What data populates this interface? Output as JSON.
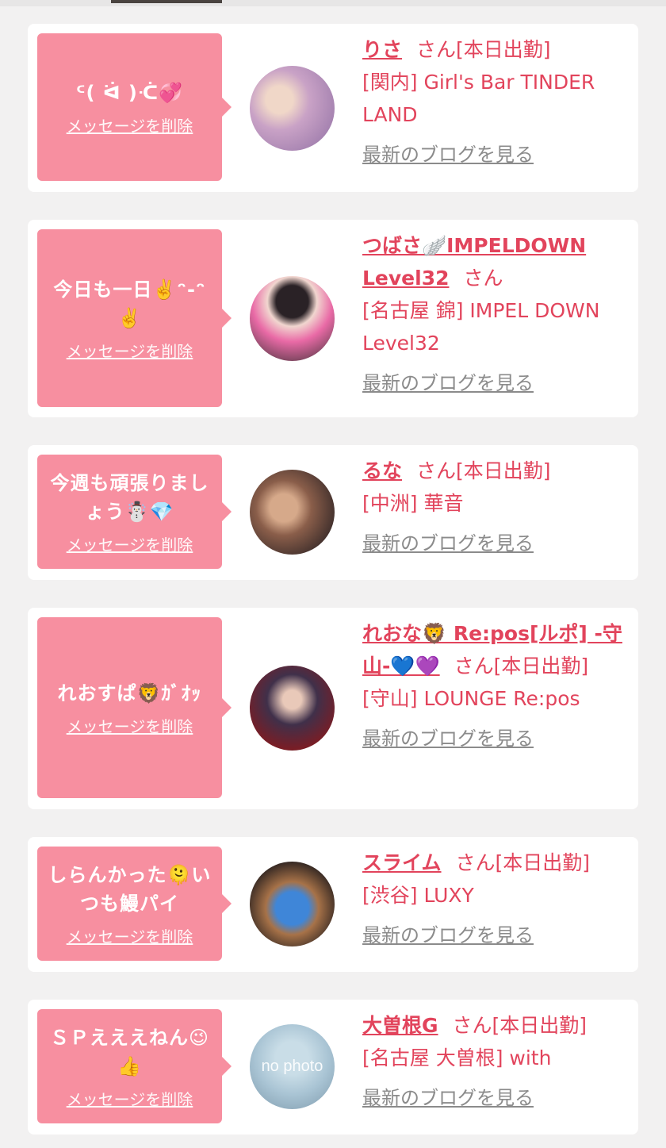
{
  "cards": [
    {
      "message": "ᑦ( ᐛ )ᑣ💞",
      "delete_label": "メッセージを削除",
      "name": "りさ",
      "san": "さん[本日出勤]",
      "shop": "[関内] Girl's Bar TINDER LAND",
      "blog_label": "最新のブログを見る",
      "avatar_colors": [
        "#c9a2c6",
        "#e6c7b4"
      ]
    },
    {
      "message": "今日も一日✌️ᵔ-ᵔ✌️",
      "delete_label": "メッセージを削除",
      "name": "つばさ🪽IMPELDOWN Level32",
      "san": "さん",
      "shop": "[名古屋 錦] IMPEL DOWN Level32",
      "blog_label": "最新のブログを見る",
      "avatar_colors": [
        "#e96aa6",
        "#2a2226"
      ]
    },
    {
      "message": "今週も頑張りましょう☃️💎",
      "delete_label": "メッセージを削除",
      "name": "るな",
      "san": "さん[本日出勤]",
      "shop": "[中洲] 華音",
      "blog_label": "最新のブログを見る",
      "avatar_colors": [
        "#3b2c2a",
        "#d6a98a"
      ]
    },
    {
      "message": "れおすぱ🦁ｶﾞｵｯ",
      "delete_label": "メッセージを削除",
      "name": "れおな🦁 Re:pos[ルポ] -守山-💙💜",
      "san": "さん[本日出勤]",
      "shop": "[守山] LOUNGE Re:pos",
      "blog_label": "最新のブログを見る",
      "avatar_colors": [
        "#7a1d25",
        "#40304a"
      ]
    },
    {
      "message": "しらんかった🫠いつも鰻パイ",
      "delete_label": "メッセージを削除",
      "name": "スライム",
      "san": "さん[本日出勤]",
      "shop": "[渋谷] LUXY",
      "blog_label": "最新のブログを見る",
      "avatar_colors": [
        "#1f1a1c",
        "#3f86d8"
      ]
    },
    {
      "message": "ＳＰえええねん😉👍",
      "delete_label": "メッセージを削除",
      "name": "大曽根G",
      "san": "さん[本日出勤]",
      "shop": "[名古屋 大曽根] with",
      "blog_label": "最新のブログを見る",
      "avatar_text": "no photo",
      "avatar_colors": [
        "#a9c4d4",
        "#7c98aa"
      ]
    }
  ]
}
